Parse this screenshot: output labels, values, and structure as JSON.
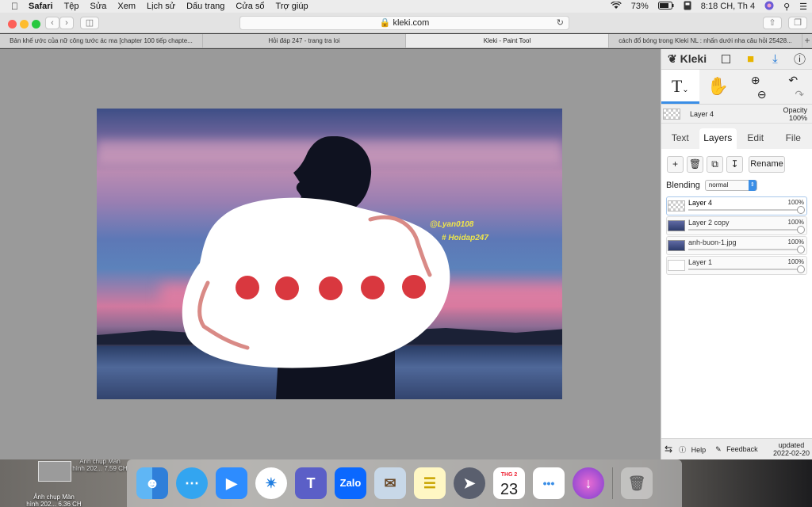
{
  "menubar": {
    "apple_icon": "apple-icon",
    "app_name": "Safari",
    "items": [
      "Tệp",
      "Sửa",
      "Xem",
      "Lịch sử",
      "Dấu trang",
      "Cửa sổ",
      "Trợ giúp"
    ],
    "battery": "73%",
    "clock": "8:18 CH, Th 4"
  },
  "browser": {
    "url": "kleki.com",
    "tabs": [
      "Bản khế ước của nữ công tước ác ma [chapter 100 tiếp chapte...",
      "Hỏi đáp 247 - trang tra loi",
      "Kleki - Paint Tool",
      "cách đổ bóng trong Kleki NL : nhấn dưới nha câu hỏi 25428..."
    ],
    "active_tab": 2
  },
  "canvas": {
    "watermark_1": "@Lyan0108",
    "watermark_2": "# Hoidap247"
  },
  "panel": {
    "logo": "Kleki",
    "current_layer": "Layer 4",
    "opacity_label": "Opacity",
    "opacity_value": "100%",
    "tabs": [
      "Text",
      "Layers",
      "Edit",
      "File"
    ],
    "active_tab": "Layers",
    "rename": "Rename",
    "blending_label": "Blending",
    "blending_value": "normal",
    "layers": [
      {
        "name": "Layer 4",
        "opacity": "100%"
      },
      {
        "name": "Layer 2 copy",
        "opacity": "100%"
      },
      {
        "name": "anh-buon-1.jpg",
        "opacity": "100%"
      },
      {
        "name": "Layer 1",
        "opacity": "100%"
      }
    ],
    "footer": {
      "help": "Help",
      "feedback": "Feedback",
      "updated_1": "updated",
      "updated_2": "2022-02-20"
    }
  },
  "desktop": {
    "file1_a": "Ảnh chụp Màn",
    "file1_b": "hình 202... 7.59 CH",
    "file2_a": "Ảnh chụp Màn",
    "file2_b": "hình 202... 6.36 CH"
  },
  "dock": {
    "zalo_label": "Zalo",
    "calendar_month": "THG 2",
    "calendar_day": "23"
  },
  "colors": {
    "accent": "#3a8ee6",
    "dot_red": "#d9383f",
    "watermark": "#f0e64a"
  }
}
